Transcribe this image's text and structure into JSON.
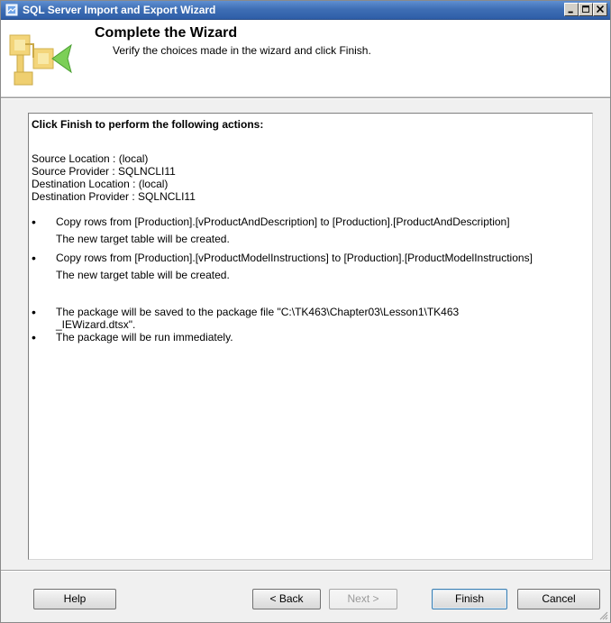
{
  "window": {
    "title": "SQL Server Import and Export Wizard"
  },
  "header": {
    "title": "Complete the Wizard",
    "subtitle": "Verify the choices made in the wizard and click Finish."
  },
  "content": {
    "heading": "Click Finish to perform the following actions:",
    "info": [
      "Source Location : (local)",
      "Source Provider : SQLNCLI11",
      "Destination Location : (local)",
      "Destination Provider : SQLNCLI11"
    ],
    "bullet_symbol": "•",
    "actions": [
      {
        "line1": "Copy rows from [Production].[vProductAndDescription] to [Production].[ProductAndDescription]",
        "line2": "The new target table will be created."
      },
      {
        "line1": "Copy rows from [Production].[vProductModelInstructions] to [Production].[ProductModelInstructions]",
        "line2": "The new target table will be created."
      }
    ],
    "package_save": [
      "The package will be saved to the package file \"C:\\TK463\\Chapter03\\Lesson1\\TK463",
      "_IEWizard.dtsx\"."
    ],
    "run_now": "The package will be run immediately."
  },
  "buttons": {
    "help": "Help",
    "back": "< Back",
    "next": "Next >",
    "finish": "Finish",
    "cancel": "Cancel"
  },
  "icons": {
    "app": "database-wizard-icon",
    "minimize": "minimize-icon",
    "maximize": "maximize-icon",
    "close": "close-icon",
    "wizard": "wizard-art-icon",
    "resize": "resize-grip-icon"
  },
  "colors": {
    "titlebar": "#3f6fb5",
    "window_background": "#f0f0f0",
    "content_background": "#ffffff",
    "disabled_text": "#9a9a9a"
  }
}
